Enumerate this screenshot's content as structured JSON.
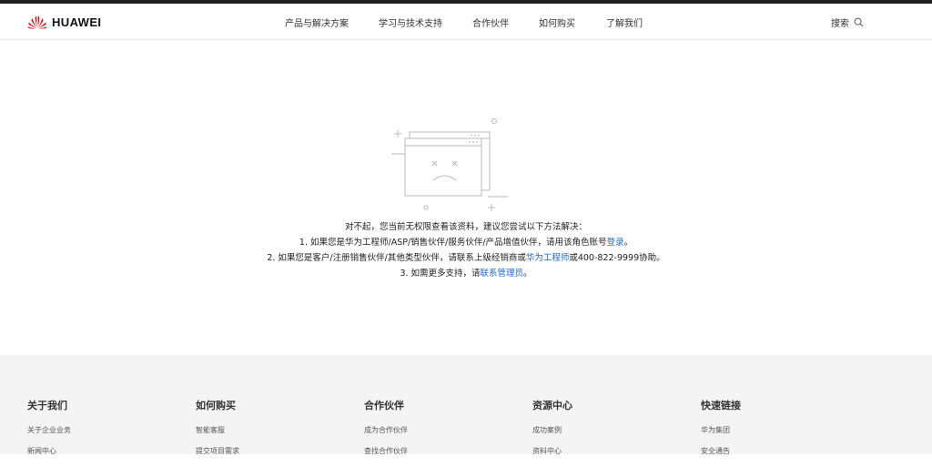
{
  "brand": {
    "name": "HUAWEI",
    "logo_color": "#e60012"
  },
  "nav": {
    "items": [
      {
        "label": "产品与解决方案"
      },
      {
        "label": "学习与技术支持"
      },
      {
        "label": "合作伙伴"
      },
      {
        "label": "如何购买"
      },
      {
        "label": "了解我们"
      }
    ],
    "search_label": "搜索"
  },
  "message": {
    "intro": "对不起，您当前无权限查看该资料，建议您尝试以下方法解决：",
    "line1_prefix": "1. 如果您是华为工程师/ASP/销售伙伴/服务伙伴/产品增值伙伴，请用该角色账号",
    "line1_link": "登录",
    "line1_suffix": "。",
    "line2_prefix": "2. 如果您是客户/注册销售伙伴/其他类型伙伴，请联系上级经销商或",
    "line2_link": "华为工程师",
    "line2_suffix": "或400-822-9999协助。",
    "line3_prefix": "3. 如需更多支持，请",
    "line3_link": "联系管理员",
    "line3_suffix": "。",
    "link_color": "#1a6bc7"
  },
  "footer": {
    "columns": [
      {
        "title": "关于我们",
        "links": [
          "关于企业业务",
          "新闻中心"
        ]
      },
      {
        "title": "如何购买",
        "links": [
          "智能客服",
          "提交项目需求"
        ]
      },
      {
        "title": "合作伙伴",
        "links": [
          "成为合作伙伴",
          "查找合作伙伴"
        ]
      },
      {
        "title": "资源中心",
        "links": [
          "成功案例",
          "资料中心"
        ]
      },
      {
        "title": "快速链接",
        "links": [
          "华为集团",
          "安全通告"
        ]
      }
    ]
  }
}
